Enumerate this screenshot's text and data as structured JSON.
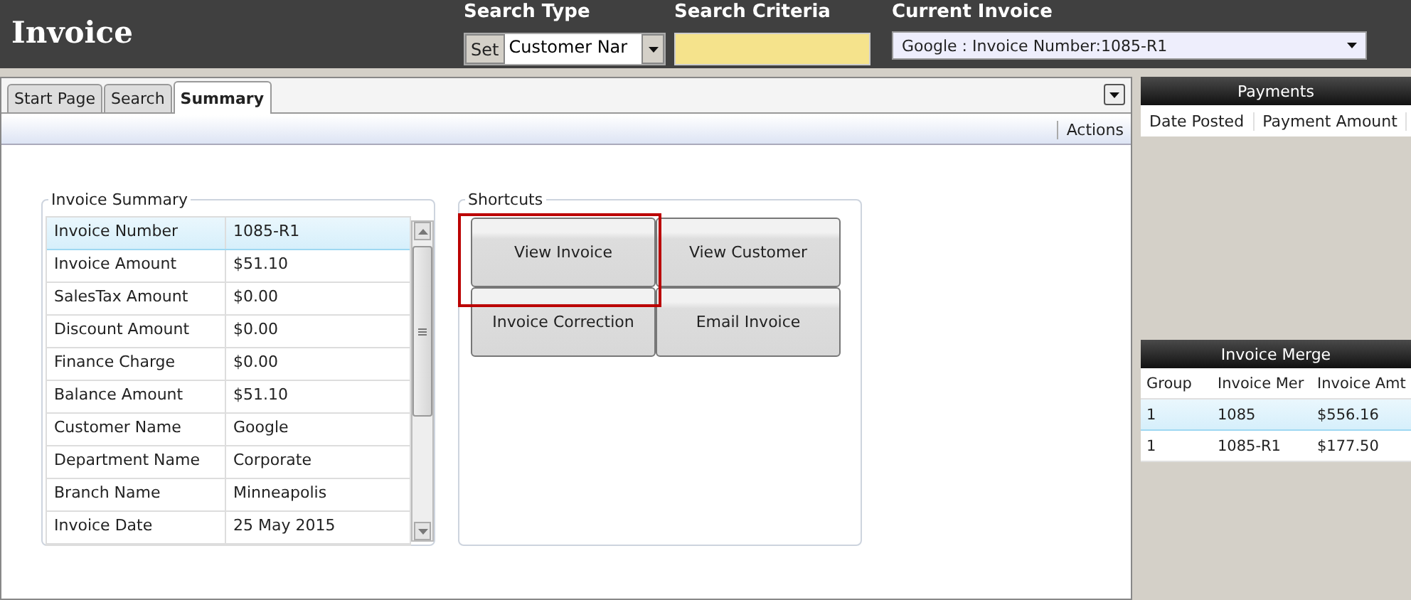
{
  "header": {
    "title": "Invoice",
    "search_type": {
      "label": "Search Type",
      "button": "Set",
      "value": "Customer Nar"
    },
    "search_criteria": {
      "label": "Search Criteria"
    },
    "current_invoice": {
      "label": "Current Invoice",
      "value": "Google : Invoice Number:1085-R1"
    }
  },
  "tabs": [
    {
      "label": "Start Page",
      "selected": false
    },
    {
      "label": "Search",
      "selected": false
    },
    {
      "label": "Summary",
      "selected": true
    }
  ],
  "toolbar": {
    "actions": "Actions"
  },
  "invoice_summary": {
    "title": "Invoice Summary",
    "rows": [
      {
        "label": "Invoice Number",
        "value": "1085-R1",
        "selected": true
      },
      {
        "label": "Invoice Amount",
        "value": "$51.10",
        "selected": false
      },
      {
        "label": "SalesTax Amount",
        "value": "$0.00",
        "selected": false
      },
      {
        "label": "Discount Amount",
        "value": "$0.00",
        "selected": false
      },
      {
        "label": "Finance Charge",
        "value": "$0.00",
        "selected": false
      },
      {
        "label": "Balance Amount",
        "value": "$51.10",
        "selected": false
      },
      {
        "label": "Customer Name",
        "value": "Google",
        "selected": false
      },
      {
        "label": "Department Name",
        "value": "Corporate",
        "selected": false
      },
      {
        "label": "Branch Name",
        "value": "Minneapolis",
        "selected": false
      },
      {
        "label": "Invoice Date",
        "value": "25 May 2015",
        "selected": false
      }
    ]
  },
  "shortcuts": {
    "title": "Shortcuts",
    "buttons": [
      {
        "label": "View Invoice",
        "highlighted": true
      },
      {
        "label": "View Customer",
        "highlighted": false
      },
      {
        "label": "Invoice Correction",
        "highlighted": false
      },
      {
        "label": "Email Invoice",
        "highlighted": false
      }
    ]
  },
  "payments": {
    "title": "Payments",
    "columns": [
      "Date Posted",
      "Payment Amount"
    ]
  },
  "invoice_merge": {
    "title": "Invoice Merge",
    "columns": [
      "Group",
      "Invoice Mer",
      "Invoice Amt"
    ],
    "rows": [
      {
        "cells": [
          "1",
          "1085",
          "$556.16"
        ],
        "selected": true
      },
      {
        "cells": [
          "1",
          "1085-R1",
          "$177.50"
        ],
        "selected": false
      }
    ]
  }
}
